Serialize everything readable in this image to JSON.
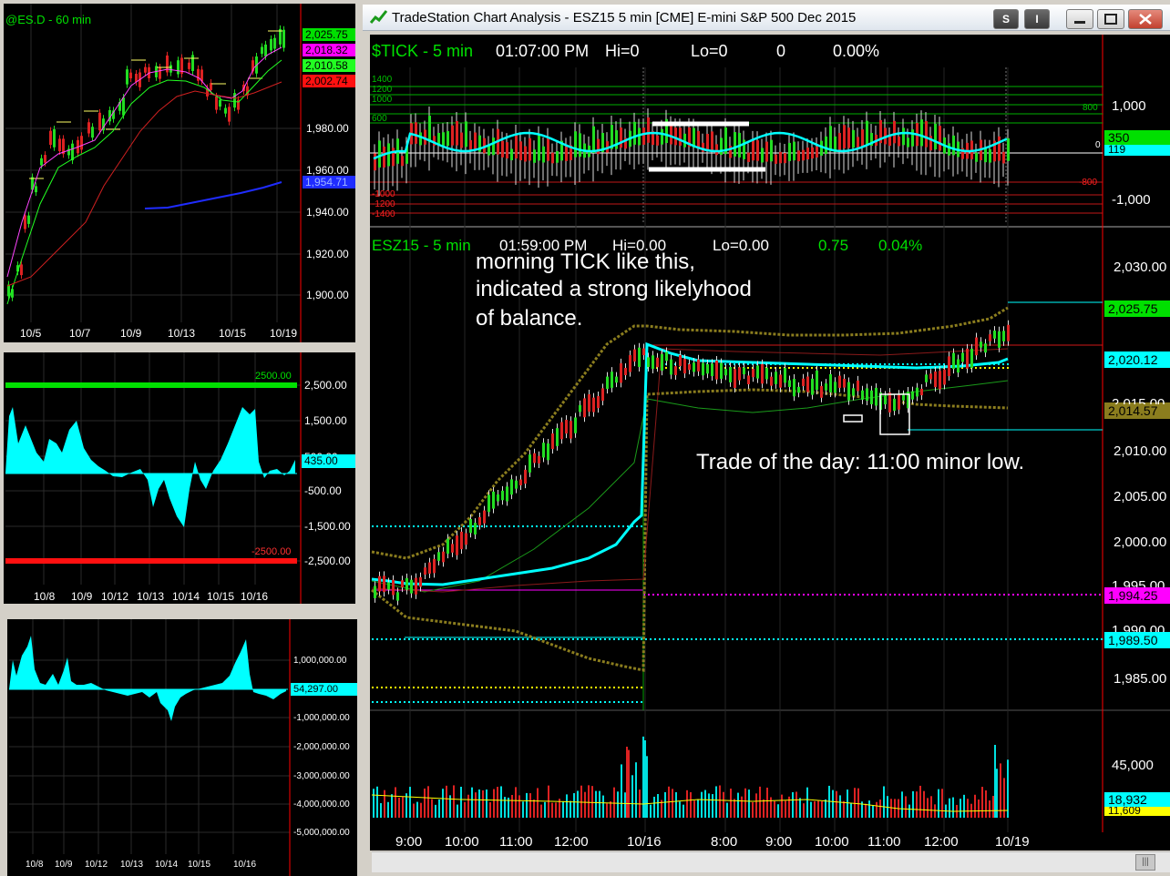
{
  "window": {
    "title": "TradeStation Chart Analysis - ESZ15 5 min [CME] E-mini S&P 500 Dec 2015",
    "buttons": [
      "S",
      "I"
    ]
  },
  "colors": {
    "green": "#00e000",
    "magenta": "#ff00ff",
    "red": "#ff0000",
    "blue": "#0000ff",
    "cyan": "#00ffff",
    "olive": "#8b7d1e",
    "yellow": "#ffff00"
  },
  "panel_es60": {
    "symbol_label": "@ES.D - 60 min",
    "price_ticks": [
      "1,980.00",
      "1,960.00",
      "1,940.00",
      "1,920.00",
      "1,900.00"
    ],
    "badges": [
      "2,025.75",
      "2,018.32",
      "2,010.58",
      "2,002.74",
      "1,954.71"
    ],
    "date_ticks": [
      "10/5",
      "10/7",
      "10/9",
      "10/13",
      "10/15",
      "10/19"
    ]
  },
  "panel_osc1": {
    "upper_line_label": "2500.00",
    "lower_line_label": "-2500.00",
    "ticks": [
      "2,500.00",
      "1,500.00",
      "-500.00",
      "-1,500.00",
      "-2,500.00"
    ],
    "current_badge": "435.00",
    "hidden_tick": "500.00",
    "date_ticks": [
      "10/8",
      "10/9",
      "10/12",
      "10/13",
      "10/14",
      "10/15",
      "10/16"
    ]
  },
  "panel_osc2": {
    "ticks": [
      "1,000,000.00",
      "-1,000,000.00",
      "-2,000,000.00",
      "-3,000,000.00",
      "-4,000,000.00",
      "-5,000,000.00"
    ],
    "current_badge": "54,297.00",
    "date_ticks": [
      "10/8",
      "10/9",
      "10/12",
      "10/13",
      "10/14",
      "10/15",
      "10/16"
    ]
  },
  "tick_panel": {
    "header": "$TICK - 5 min",
    "time": "01:07:00 PM",
    "hi": "Hi=0",
    "lo": "Lo=0",
    "last": "0",
    "pct": "0.00%",
    "level_labels": [
      "1400",
      "1200",
      "1000",
      "600",
      "-1000",
      "-1200",
      "-1400"
    ],
    "inner_labels": [
      "800",
      "0",
      "-800"
    ],
    "axis_ticks": [
      "1,000",
      "-1,000"
    ],
    "badges": [
      "350",
      "119"
    ]
  },
  "es_panel": {
    "header": "ESZ15 - 5 min",
    "time": "01:59:00 PM",
    "hi": "Hi=0.00",
    "lo": "Lo=0.00",
    "chg": "0.75",
    "pct": "0.04%",
    "annotation_1": "morning TICK like this,",
    "annotation_2": "indicated a strong likelyhood",
    "annotation_3": "of balance.",
    "annotation_trade": "Trade of the day: 11:00 minor low.",
    "axis_ticks": [
      "2,030.00",
      "2,010.00",
      "2,005.00",
      "2,000.00",
      "1,985.00"
    ],
    "partial_ticks": [
      "2,015.00",
      "1,995.00",
      "1,990.00"
    ],
    "badges": [
      "2,025.75",
      "2,020.12",
      "2,014.57",
      "1,994.25",
      "1,989.50"
    ]
  },
  "volume_panel": {
    "axis_tick": "45,000",
    "badges": [
      "18,932",
      "11,609"
    ]
  },
  "time_axis": [
    "9:00",
    "10:00",
    "11:00",
    "12:00",
    "10/16",
    "8:00",
    "9:00",
    "10:00",
    "11:00",
    "12:00",
    "10/19"
  ],
  "scroll_thumb": "|||"
}
